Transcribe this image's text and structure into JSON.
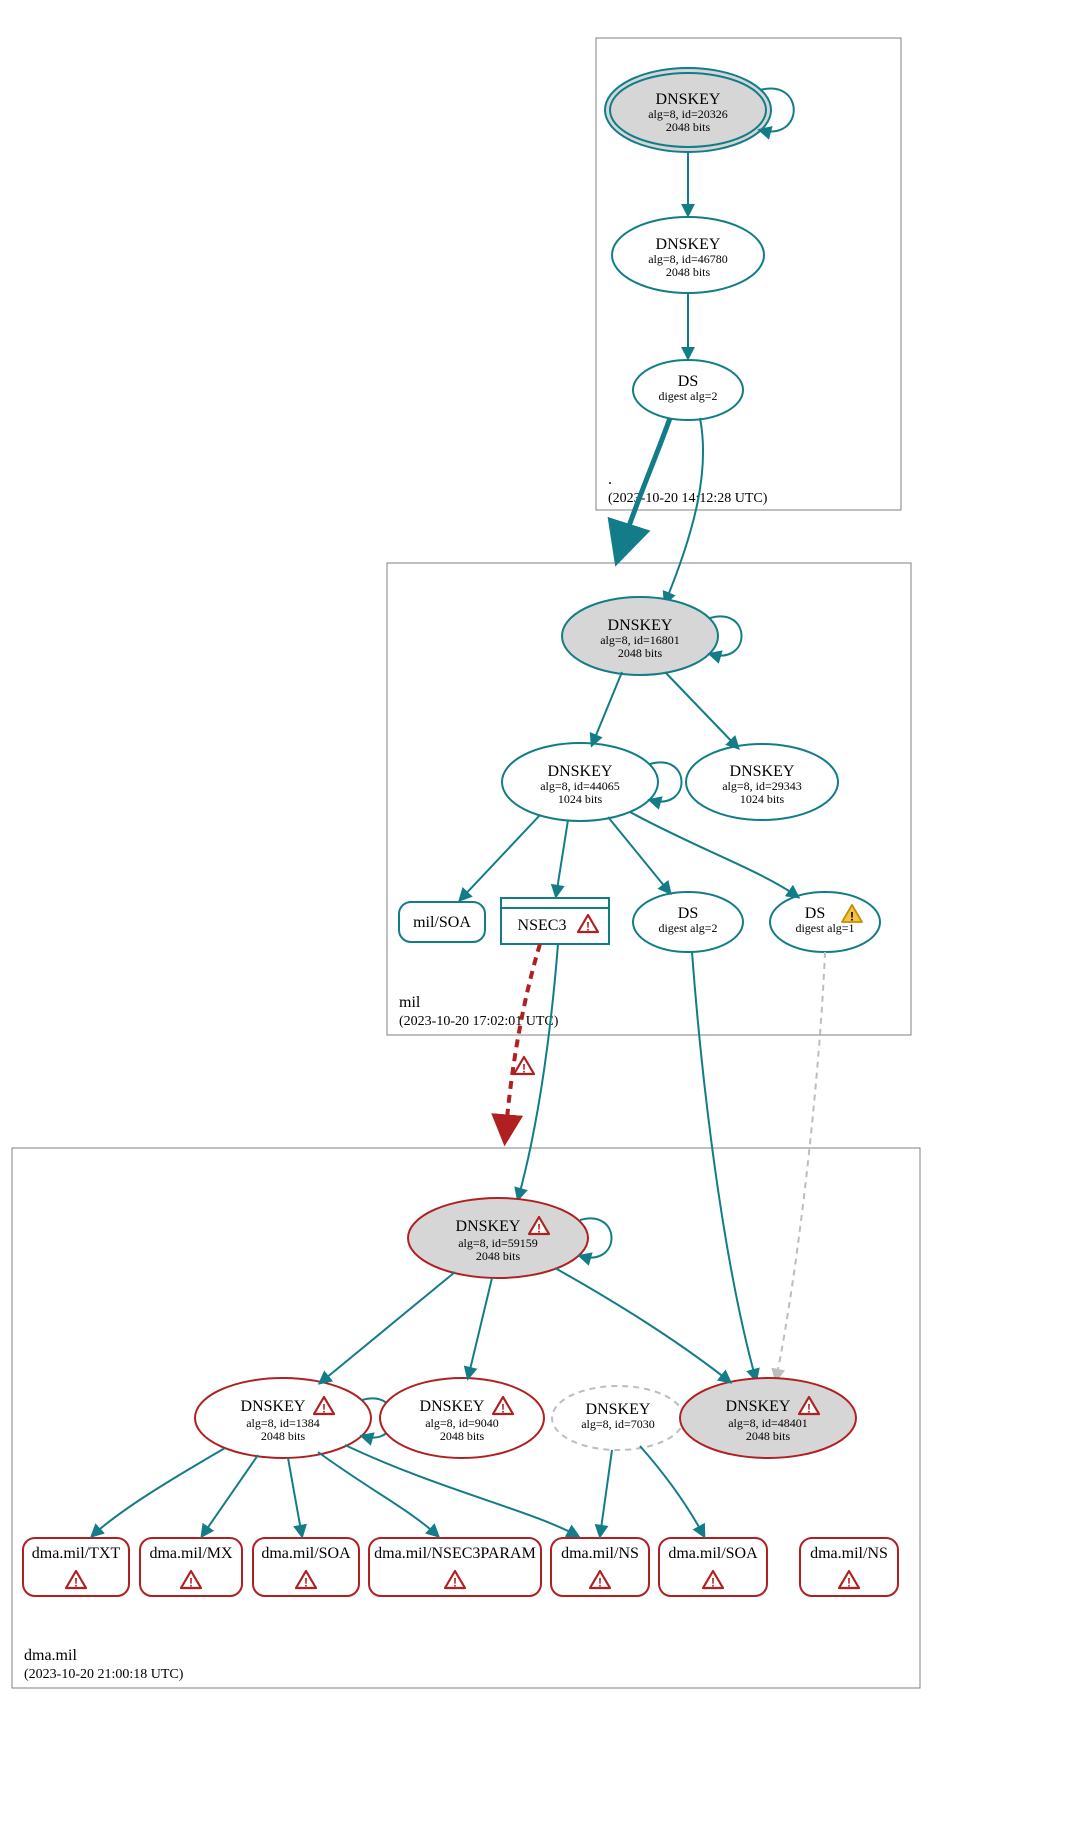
{
  "zones": {
    "root": {
      "title": ".",
      "timestamp": "(2023-10-20 14:12:28 UTC)"
    },
    "mil": {
      "title": "mil",
      "timestamp": "(2023-10-20 17:02:01 UTC)"
    },
    "dma": {
      "title": "dma.mil",
      "timestamp": "(2023-10-20 21:00:18 UTC)"
    }
  },
  "nodes": {
    "root_ksk": {
      "title": "DNSKEY",
      "sub1": "alg=8, id=20326",
      "sub2": "2048 bits"
    },
    "root_zsk": {
      "title": "DNSKEY",
      "sub1": "alg=8, id=46780",
      "sub2": "2048 bits"
    },
    "root_ds": {
      "title": "DS",
      "sub1": "digest alg=2"
    },
    "mil_ksk": {
      "title": "DNSKEY",
      "sub1": "alg=8, id=16801",
      "sub2": "2048 bits"
    },
    "mil_zsk": {
      "title": "DNSKEY",
      "sub1": "alg=8, id=44065",
      "sub2": "1024 bits"
    },
    "mil_zsk2": {
      "title": "DNSKEY",
      "sub1": "alg=8, id=29343",
      "sub2": "1024 bits"
    },
    "mil_soa": {
      "title": "mil/SOA"
    },
    "mil_nsec3": {
      "title": "NSEC3"
    },
    "mil_ds2": {
      "title": "DS",
      "sub1": "digest alg=2"
    },
    "mil_ds1": {
      "title": "DS",
      "sub1": "digest alg=1"
    },
    "dma_ksk": {
      "title": "DNSKEY",
      "sub1": "alg=8, id=59159",
      "sub2": "2048 bits"
    },
    "dma_zsk1": {
      "title": "DNSKEY",
      "sub1": "alg=8, id=1384",
      "sub2": "2048 bits"
    },
    "dma_zsk2": {
      "title": "DNSKEY",
      "sub1": "alg=8, id=9040",
      "sub2": "2048 bits"
    },
    "dma_gray": {
      "title": "DNSKEY",
      "sub1": "alg=8, id=7030"
    },
    "dma_zsk3": {
      "title": "DNSKEY",
      "sub1": "alg=8, id=48401",
      "sub2": "2048 bits"
    },
    "rr_txt": {
      "title": "dma.mil/TXT"
    },
    "rr_mx": {
      "title": "dma.mil/MX"
    },
    "rr_soa": {
      "title": "dma.mil/SOA"
    },
    "rr_nsec3p": {
      "title": "dma.mil/NSEC3PARAM"
    },
    "rr_ns": {
      "title": "dma.mil/NS"
    },
    "rr_soa2": {
      "title": "dma.mil/SOA"
    },
    "rr_ns2": {
      "title": "dma.mil/NS"
    }
  },
  "colors": {
    "teal": "#127c88",
    "red": "#b02020",
    "yellow": "#f6c343",
    "boxgray": "#808080",
    "nodegray": "#d6d6d6",
    "dashgray": "#bdbdbd"
  }
}
